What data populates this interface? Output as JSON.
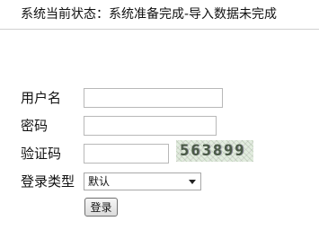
{
  "status": {
    "text": "系统当前状态：系统准备完成-导入数据未完成"
  },
  "login_form": {
    "username_label": "用户名",
    "username_value": "",
    "password_label": "密码",
    "password_value": "",
    "captcha_label": "验证码",
    "captcha_value": "",
    "captcha_image_text": "563899",
    "login_type_label": "登录类型",
    "login_type_selected": "默认",
    "submit_label": "登录"
  }
}
